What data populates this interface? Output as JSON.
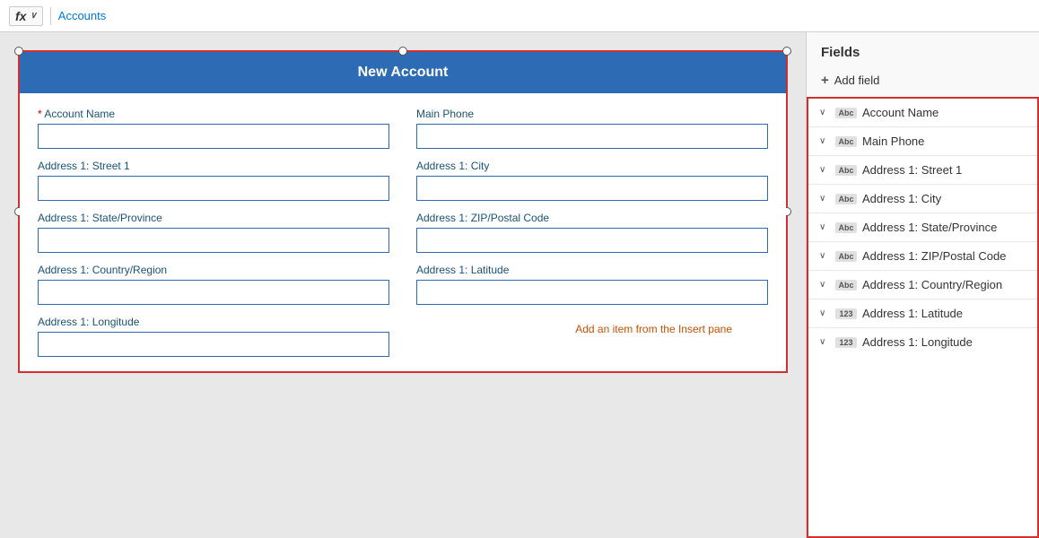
{
  "topbar": {
    "fx_label": "fx",
    "fx_chevron": "∨",
    "breadcrumb": "Accounts"
  },
  "form": {
    "title": "New Account",
    "add_item_hint": "Add an item from the Insert pane",
    "fields": [
      {
        "label": "Account Name",
        "required": true,
        "col": 0
      },
      {
        "label": "Main Phone",
        "required": false,
        "col": 1
      },
      {
        "label": "Address 1: Street 1",
        "required": false,
        "col": 0
      },
      {
        "label": "Address 1: City",
        "required": false,
        "col": 1
      },
      {
        "label": "Address 1: State/Province",
        "required": false,
        "col": 0
      },
      {
        "label": "Address 1: ZIP/Postal Code",
        "required": false,
        "col": 1
      },
      {
        "label": "Address 1: Country/Region",
        "required": false,
        "col": 0
      },
      {
        "label": "Address 1: Latitude",
        "required": false,
        "col": 1
      },
      {
        "label": "Address 1: Longitude",
        "required": false,
        "col": 0
      }
    ]
  },
  "sidebar": {
    "title": "Fields",
    "add_field_label": "Add field",
    "fields": [
      {
        "label": "Account Name",
        "type": "Abc",
        "type_display": "Abc"
      },
      {
        "label": "Main Phone",
        "type": "Abc",
        "type_display": "Abc"
      },
      {
        "label": "Address 1: Street 1",
        "type": "Abc",
        "type_display": "Abc"
      },
      {
        "label": "Address 1: City",
        "type": "Abc",
        "type_display": "Abc"
      },
      {
        "label": "Address 1: State/Province",
        "type": "Abc",
        "type_display": "Abc"
      },
      {
        "label": "Address 1: ZIP/Postal Code",
        "type": "Abc",
        "type_display": "Abc"
      },
      {
        "label": "Address 1: Country/Region",
        "type": "Abc",
        "type_display": "Abc"
      },
      {
        "label": "Address 1: Latitude",
        "type": "123",
        "type_display": "123"
      },
      {
        "label": "Address 1: Longitude",
        "type": "123",
        "type_display": "123"
      }
    ]
  }
}
